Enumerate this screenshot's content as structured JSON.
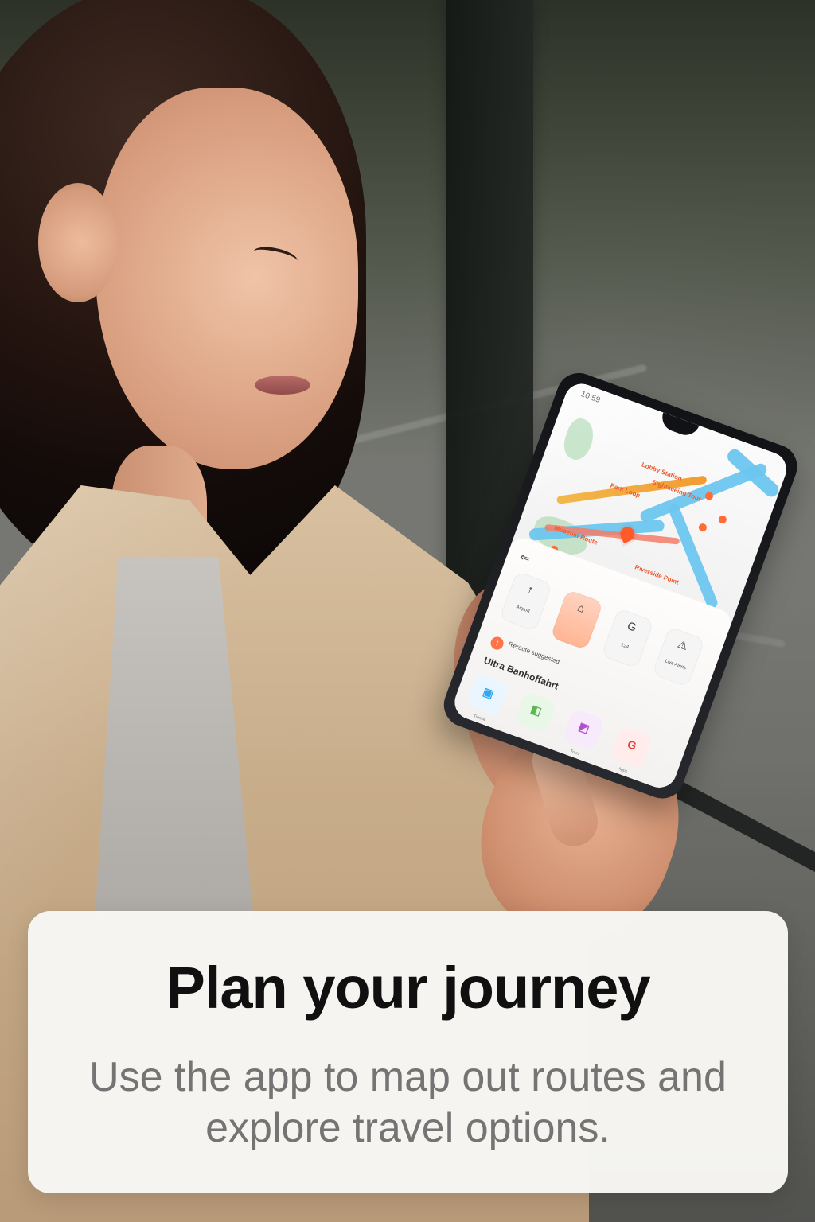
{
  "caption": {
    "title": "Plan your journey",
    "subtitle": "Use the app to map out routes and explore travel options."
  },
  "phone": {
    "status_time": "10:59",
    "map_labels": [
      "Lobby Station",
      "Sightseeing Tour",
      "Park Loop",
      "Museum Route",
      "Riverside Point"
    ],
    "options": [
      {
        "icon": "↑",
        "label": "Airport"
      },
      {
        "icon": "⌂",
        "label": ""
      },
      {
        "icon": "G",
        "label": "124"
      },
      {
        "icon": "⚠",
        "label": "Live Alerts"
      }
    ],
    "result_badge": "!",
    "result_text": "Reroute suggested",
    "section_title": "Ultra Banhoffahrt",
    "tabs": [
      {
        "glyph": "▣",
        "label": "Transit"
      },
      {
        "glyph": "◧",
        "label": ""
      },
      {
        "glyph": "◩",
        "label": "Tours"
      },
      {
        "glyph": "G",
        "label": "Apps"
      }
    ]
  }
}
